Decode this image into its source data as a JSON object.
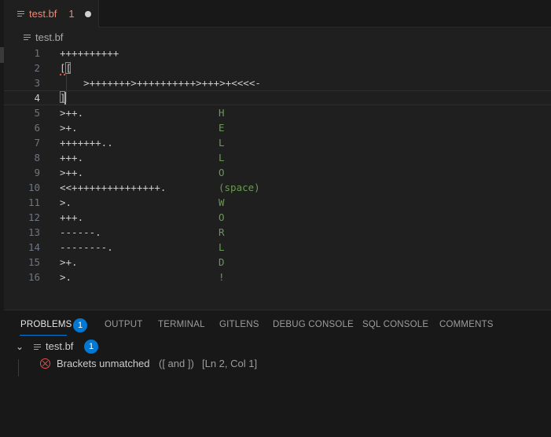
{
  "tab": {
    "file_name": "test.bf",
    "problem_count": "1"
  },
  "breadcrumb": {
    "file_name": "test.bf"
  },
  "editor": {
    "lines": [
      {
        "number": "1",
        "code": "++++++++++",
        "comment": ""
      },
      {
        "number": "2",
        "code": "[[",
        "comment": ""
      },
      {
        "number": "3",
        "code": "    >+++++++>++++++++++>+++>+<<<<-",
        "comment": ""
      },
      {
        "number": "4",
        "code": "]",
        "comment": ""
      },
      {
        "number": "5",
        "code": ">++.",
        "comment": "H"
      },
      {
        "number": "6",
        "code": ">+.",
        "comment": "E"
      },
      {
        "number": "7",
        "code": "+++++++..",
        "comment": "L"
      },
      {
        "number": "8",
        "code": "+++.",
        "comment": "L"
      },
      {
        "number": "9",
        "code": ">++.",
        "comment": "O"
      },
      {
        "number": "10",
        "code": "<<+++++++++++++++.",
        "comment": "(space)"
      },
      {
        "number": "11",
        "code": ">.",
        "comment": "W"
      },
      {
        "number": "12",
        "code": "+++.",
        "comment": "O"
      },
      {
        "number": "13",
        "code": "------.",
        "comment": "R"
      },
      {
        "number": "14",
        "code": "--------.",
        "comment": "L"
      },
      {
        "number": "15",
        "code": ">+.",
        "comment": "D"
      },
      {
        "number": "16",
        "code": ">.",
        "comment": "!"
      }
    ],
    "current_line": "4"
  },
  "panel": {
    "tabs": [
      "PROBLEMS",
      "OUTPUT",
      "TERMINAL",
      "GITLENS",
      "DEBUG CONSOLE",
      "SQL CONSOLE",
      "COMMENTS"
    ],
    "problems_badge": "1",
    "file_group": {
      "file_name": "test.bf",
      "count": "1"
    },
    "problem": {
      "message": "Brackets unmatched",
      "detail": "([ and ])",
      "location": "[Ln 2, Col 1]"
    }
  },
  "colors": {
    "error": "#f14c4c",
    "accent": "#0078d4",
    "comment": "#6a9955"
  },
  "icons": [
    "file-lines-icon",
    "close-dot-icon",
    "chevron-down-icon",
    "error-icon"
  ]
}
